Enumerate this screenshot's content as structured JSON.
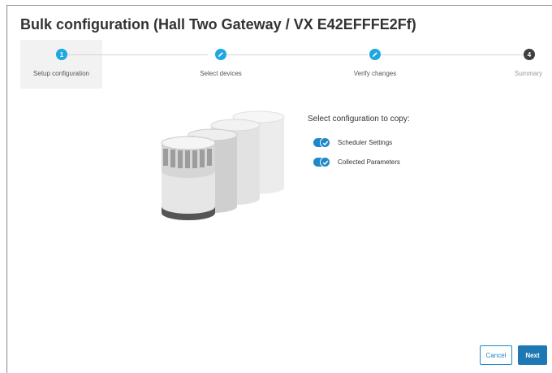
{
  "title": "Bulk configuration (Hall Two Gateway / VX E42EFFFE2Ff)",
  "stepper": {
    "steps": [
      {
        "number": "1",
        "label": "Setup configuration",
        "state": "active",
        "icon": "number"
      },
      {
        "number": "",
        "label": "Select devices",
        "state": "done",
        "icon": "pencil-icon"
      },
      {
        "number": "",
        "label": "Verify changes",
        "state": "done",
        "icon": "pencil-icon"
      },
      {
        "number": "4",
        "label": "Summary",
        "state": "future",
        "icon": "number"
      }
    ]
  },
  "illustration": {
    "icon": "database-cylinders-illustration"
  },
  "config": {
    "heading": "Select configuration to copy:",
    "options": [
      {
        "label": "Scheduler Settings",
        "checked": true
      },
      {
        "label": "Collected Parameters",
        "checked": true
      }
    ]
  },
  "actions": {
    "cancel_label": "Cancel",
    "next_label": "Next"
  },
  "colors": {
    "accent": "#1ea7e1",
    "primary_button": "#1e78b4",
    "future_step": "#3f3f3f"
  }
}
